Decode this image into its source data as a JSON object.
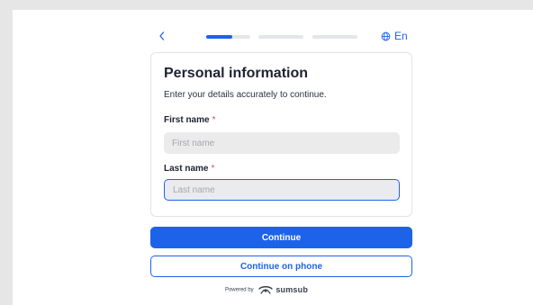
{
  "header": {
    "back_label": "<",
    "steps": [
      {
        "state": "active",
        "progress": 0.6
      },
      {
        "state": "pending",
        "progress": 0
      },
      {
        "state": "pending",
        "progress": 0
      }
    ],
    "language": "En"
  },
  "form": {
    "title": "Personal information",
    "subtitle": "Enter your details accurately to continue.",
    "first_name": {
      "label": "First name",
      "required_mark": "*",
      "placeholder": "First name",
      "value": ""
    },
    "last_name": {
      "label": "Last name",
      "required_mark": "*",
      "placeholder": "Last name",
      "value": ""
    }
  },
  "actions": {
    "continue_label": "Continue",
    "continue_phone_label": "Continue on phone"
  },
  "footer": {
    "powered_by": "Powered by",
    "brand": "sumsub"
  },
  "colors": {
    "accent": "#1d63ea",
    "required": "#e5484d",
    "input_bg": "#ebebeb",
    "page_bg": "#e6e6e6"
  },
  "icons": {
    "language": "globe-icon",
    "back": "chevron-left-icon",
    "brand": "sumsub-logo-icon"
  }
}
